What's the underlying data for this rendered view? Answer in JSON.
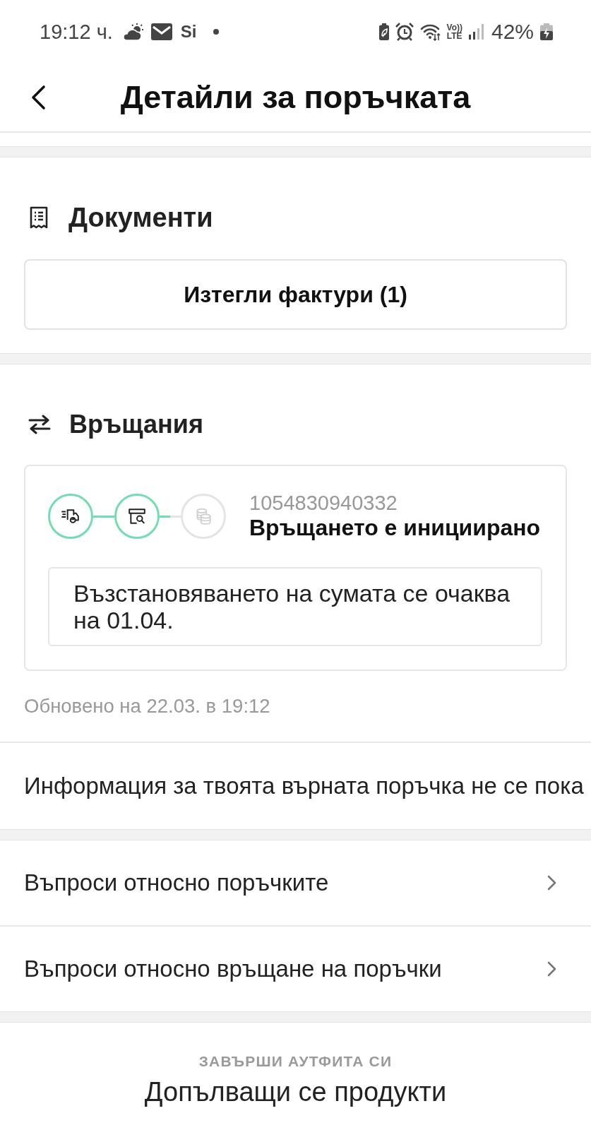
{
  "status_bar": {
    "time": "19:12 ч.",
    "app_label": "Si",
    "volte_top": "Vo))",
    "volte_bottom": "LTE",
    "battery": "42%"
  },
  "header": {
    "title": "Детайли за поръчката"
  },
  "documents": {
    "title": "Документи",
    "button": "Изтегли фактури (1)"
  },
  "returns": {
    "title": "Връщания",
    "steps": [
      {
        "kind": "shipping",
        "done": true
      },
      {
        "kind": "inspection",
        "done": true
      },
      {
        "kind": "refund",
        "done": false
      }
    ],
    "return_number": "1054830940332",
    "status": "Връщането е инициирано",
    "message": "Възстановяването на сумата се очаква на 01.04.",
    "updated": "Обновено на 22.03. в 19:12"
  },
  "info_text": "Информация за твоята върната поръчка не се пока",
  "help_links": [
    {
      "label": "Въпроси относно поръчките"
    },
    {
      "label": "Въпроси относно връщане на поръчки"
    }
  ],
  "recommendations": {
    "eyebrow": "ЗАВЪРШИ АУТФИТА СИ",
    "title": "Допълващи се продукти"
  }
}
